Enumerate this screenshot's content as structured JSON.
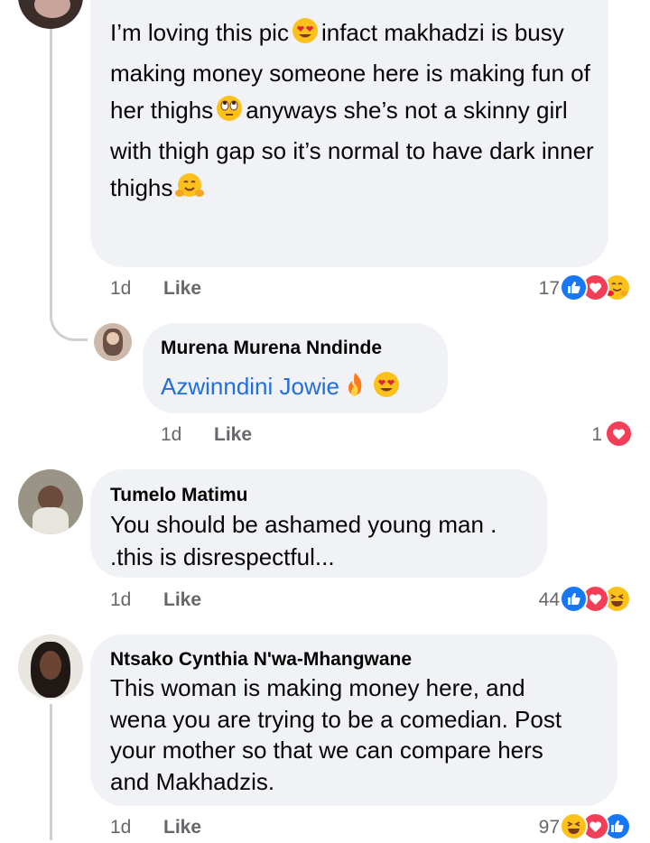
{
  "comments": [
    {
      "text_parts": [
        "I’m loving this pic",
        "infact makhadzi is busy making money someone here is making fun of her thighs",
        "anyways she’s not a skinny girl with thigh gap so it’s normal to have dark inner thighs"
      ],
      "emojis": [
        "heart-eyes",
        "rolling-eyes",
        "hugging-face"
      ],
      "time": "1d",
      "like_label": "Like",
      "reaction_count": "17",
      "reactions": [
        "like",
        "love",
        "hugging-face"
      ]
    },
    {
      "author": "Murena Murena Nndinde",
      "text": "Azwinndini Jowie",
      "emojis": [
        "fire",
        "heart-eyes"
      ],
      "time": "1d",
      "like_label": "Like",
      "reaction_count": "1",
      "reactions": [
        "love"
      ]
    },
    {
      "author": "Tumelo Matimu",
      "text_lines": [
        "You should be ashamed young man .",
        ".this is disrespectful..."
      ],
      "time": "1d",
      "like_label": "Like",
      "reaction_count": "44",
      "reactions": [
        "like",
        "love",
        "laughing"
      ]
    },
    {
      "author": "Ntsako Cynthia N'wa-Mhangwane",
      "text_lines": [
        "This woman is making money here, and",
        "wena you are trying to be a comedian. Post",
        "your mother so that we can compare hers",
        "and Makhadzis."
      ],
      "time": "1d",
      "like_label": "Like",
      "reaction_count": "97",
      "reactions": [
        "laughing",
        "love",
        "like"
      ]
    }
  ],
  "colors": {
    "bubble": "#f0f2f5",
    "meta": "#65676b",
    "like_blue": "#1877f2",
    "love_red": "#f33e58",
    "emoji_yellow": "#fcc21b",
    "link_blue": "#216fdb"
  }
}
